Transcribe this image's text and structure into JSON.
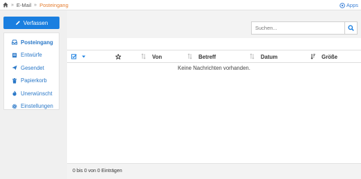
{
  "breadcrumb": {
    "home_icon": "home-icon",
    "items": [
      "E-Mail",
      "Posteingang"
    ]
  },
  "apps": {
    "label": "Apps",
    "icon": "circle-apps-icon"
  },
  "compose": {
    "label": "Verfassen",
    "icon": "pencil-icon"
  },
  "sidebar": {
    "items": [
      {
        "label": "Posteingang",
        "icon": "inbox-icon",
        "active": true
      },
      {
        "label": "Entwürfe",
        "icon": "drafts-icon"
      },
      {
        "label": "Gesendet",
        "icon": "send-icon"
      },
      {
        "label": "Papierkorb",
        "icon": "trash-icon"
      },
      {
        "label": "Unerwünscht",
        "icon": "fire-icon"
      },
      {
        "label": "Einstellungen",
        "icon": "gear-icon"
      }
    ]
  },
  "search": {
    "placeholder": "Suchen...",
    "value": "",
    "icon": "search-icon"
  },
  "table": {
    "columns": [
      "Von",
      "Betreff",
      "Datum",
      "Größe"
    ],
    "empty_message": "Keine Nachrichten vorhanden."
  },
  "footer": {
    "info": "0 bis 0 von 0 Einträgen"
  },
  "colors": {
    "accent": "#1a7fe0",
    "link": "#2a78c8",
    "active_crumb": "#e57d2f"
  }
}
